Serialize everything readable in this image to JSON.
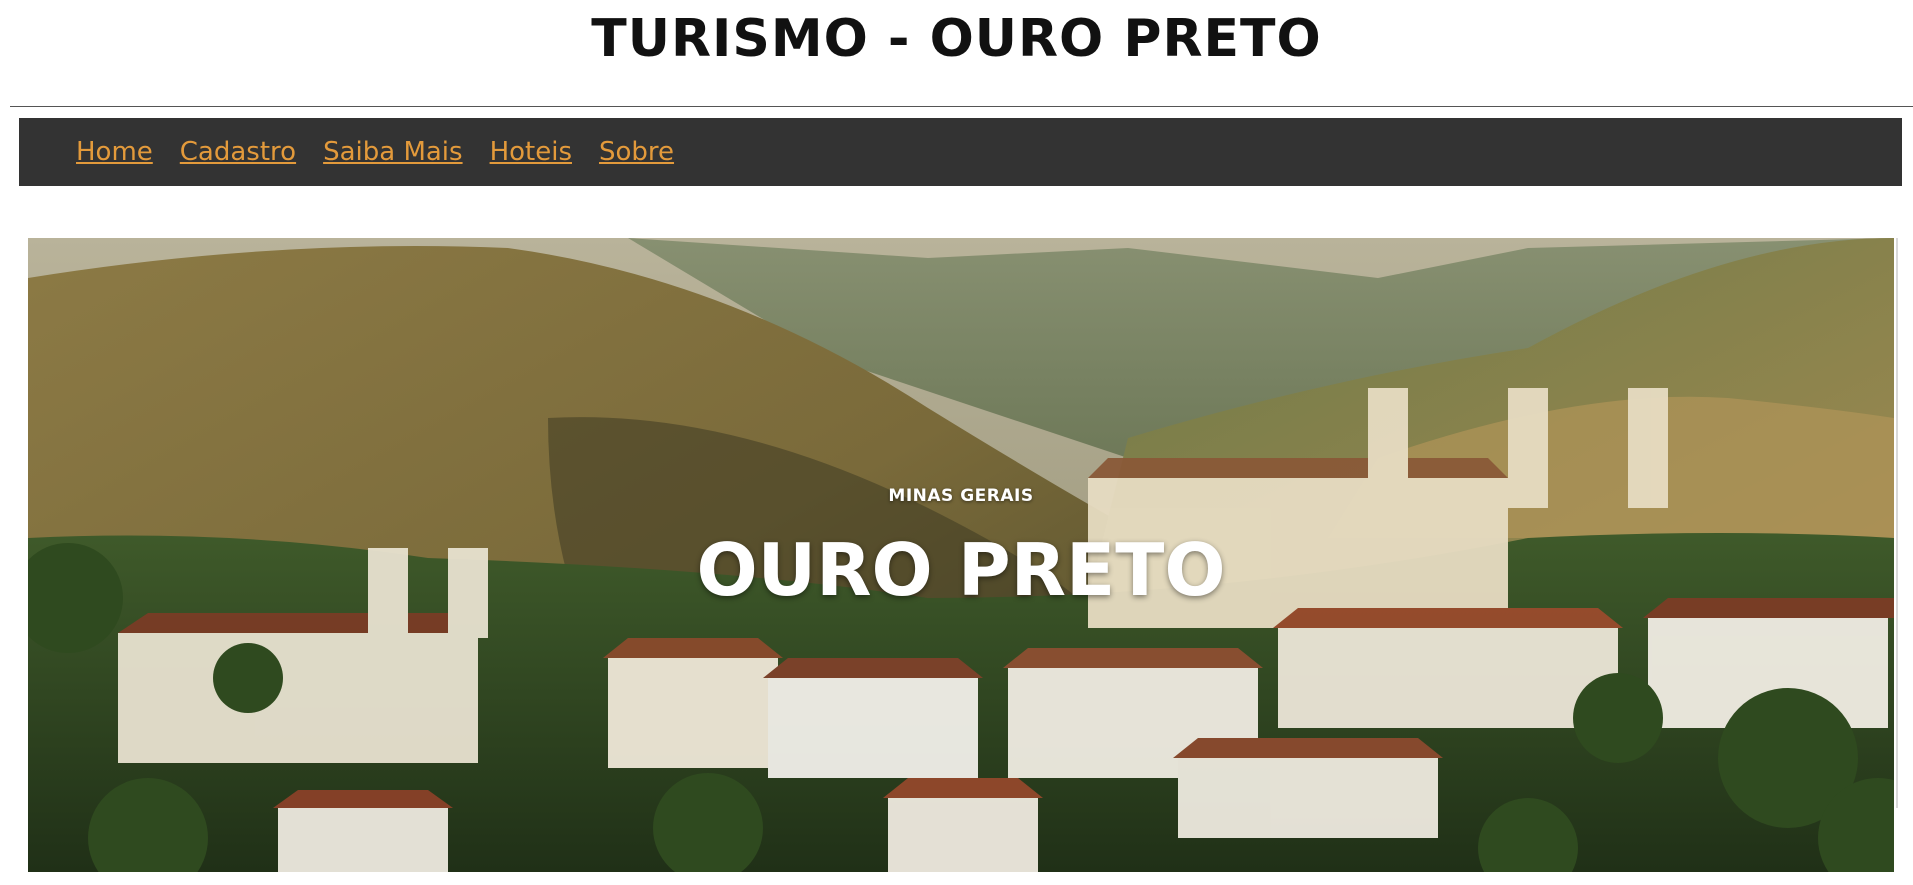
{
  "header": {
    "title": "TURISMO - OURO PRETO"
  },
  "nav": {
    "items": [
      {
        "label": "Home"
      },
      {
        "label": "Cadastro"
      },
      {
        "label": "Saiba Mais"
      },
      {
        "label": "Hoteis"
      },
      {
        "label": "Sobre"
      }
    ]
  },
  "hero": {
    "kicker": "MINAS GERAIS",
    "title": "OURO PRETO"
  },
  "colors": {
    "nav_background": "#333333",
    "nav_link": "#e39a3b",
    "title_text": "#111111"
  }
}
